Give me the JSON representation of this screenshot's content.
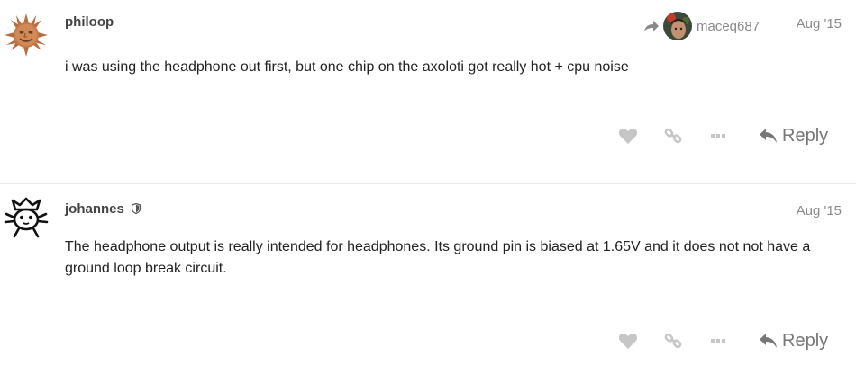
{
  "posts": [
    {
      "username": "philoop",
      "date": "Aug '15",
      "reply_to": {
        "username": "maceq687"
      },
      "body": "i was using the headphone out first, but one chip on the axoloti got really hot + cpu noise",
      "reply_label": "Reply"
    },
    {
      "username": "johannes",
      "badge_icon": "shield-icon",
      "date": "Aug '15",
      "body": "The headphone output is really intended for headphones. Its ground pin is biased at 1.65V and it does not not have a ground loop break circuit.",
      "reply_label": "Reply"
    }
  ],
  "colors": {
    "text": "#222222",
    "username": "#444444",
    "muted": "#8a8a8a",
    "icon": "#c6c6c6",
    "reply": "#777777",
    "divider": "#e9e9e9"
  }
}
